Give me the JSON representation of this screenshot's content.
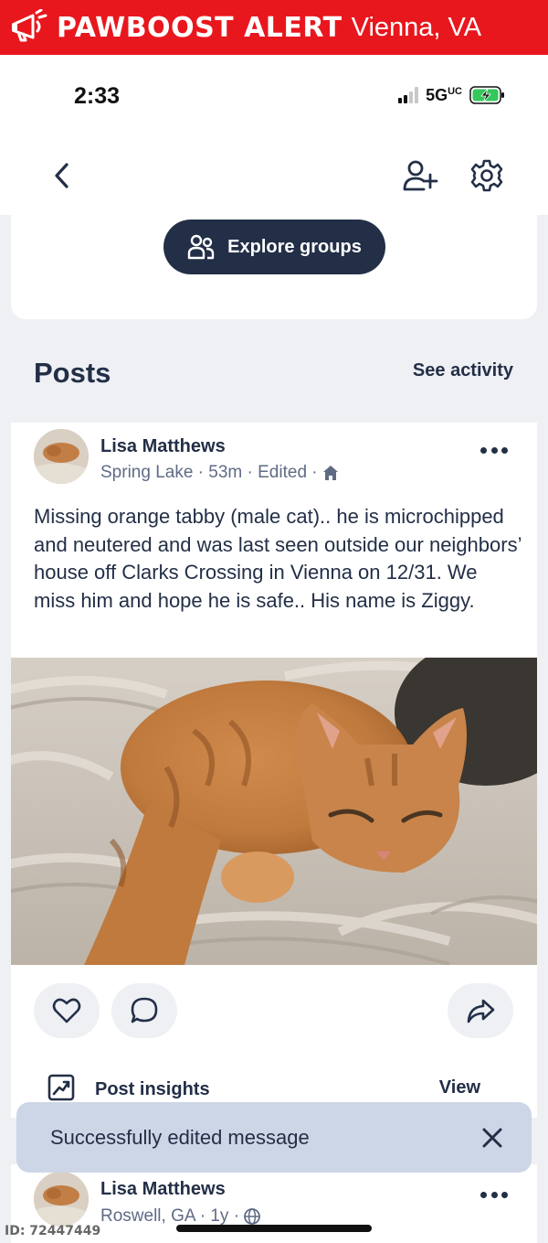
{
  "alert": {
    "brand": "PAWBOOST ALERT",
    "location": "Vienna, VA",
    "bg_color": "#e8171d",
    "icon": "megaphone-icon"
  },
  "status": {
    "time": "2:33",
    "network": "5GUC",
    "battery": "charging"
  },
  "nav": {
    "back_icon": "chevron-left-icon",
    "add_member_icon": "person-add-icon",
    "settings_icon": "gear-icon"
  },
  "groups": {
    "explore_label": "Explore groups"
  },
  "posts": {
    "title": "Posts",
    "see_activity": "See activity"
  },
  "post1": {
    "author": "Lisa Matthews",
    "meta": "Spring Lake · 53m · Edited ·",
    "text": "Missing orange tabby (male cat).. he is microchipped and neutered and was last seen outside our neighbors’ house off Clarks Crossing in Vienna on 12/31. We miss him and hope he is safe.. His name is Ziggy.",
    "insights_label": "Post insights",
    "insights_view": "View"
  },
  "toast": {
    "message": "Successfully edited message"
  },
  "post2": {
    "author": "Lisa Matthews",
    "meta": "Roswell, GA · 1y ·"
  },
  "footer": {
    "id_label": "ID: 72447449"
  }
}
